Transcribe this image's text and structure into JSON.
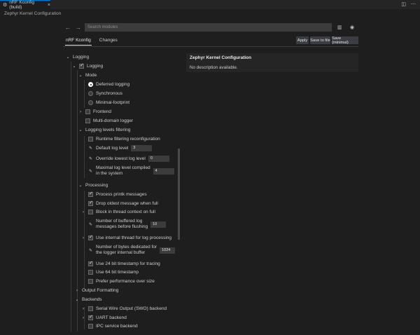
{
  "tab": {
    "title": "nRF Kconfig (build)",
    "icon": "gear-icon"
  },
  "breadcrumb": "Zephyr Kernel Configuration",
  "search": {
    "placeholder": "Search modules"
  },
  "tabs": [
    {
      "label": "nRF Kconfig"
    },
    {
      "label": "Changes"
    }
  ],
  "actions": {
    "apply": "Apply",
    "save_to_file": "Save to file",
    "save_minimal": "Save (minimal)"
  },
  "info": {
    "title": "Zephyr Kernel Configuration",
    "description": "No description available."
  },
  "tree": {
    "logging": "Logging",
    "logging_cb": "Logging",
    "mode": "Mode",
    "deferred": "Deferred logging",
    "synchronous": "Synchronous",
    "minimal": "Minimal-footprint",
    "frontend": "Frontend",
    "multi_domain": "Multi-domain logger",
    "levels_filtering": "Logging levels filtering",
    "runtime_filtering": "Runtime filtering reconfiguration",
    "default_level": "Default log level",
    "default_level_val": "3",
    "override_level": "Override lowest log level",
    "override_level_val": "0",
    "max_level_1": "Maximal log level compiled",
    "max_level_2": "in the system",
    "max_level_val": "4",
    "processing": "Processing",
    "process_printk": "Process printk messages",
    "drop_oldest": "Drop oldest message when full",
    "block_thread": "Block in thread context on full",
    "num_buffered_1": "Number of buffered log",
    "num_buffered_2": "messages before flushing",
    "num_buffered_val": "10",
    "internal_thread": "Use internal thread for log processing",
    "bytes_buffer_1": "Number of bytes dedicated for",
    "bytes_buffer_2": "the logger internal buffer",
    "bytes_buffer_val": "1024",
    "ts24": "Use 24 bit timestamp for tracing",
    "ts64": "Use 64 bit timestamp",
    "perf_size": "Prefer performance over size",
    "output_formatting": "Output Formatting",
    "backends": "Backends",
    "swo": "Serial Wire Output (SWO) backend",
    "uart": "UART backend",
    "ipc": "IPC service backend"
  }
}
